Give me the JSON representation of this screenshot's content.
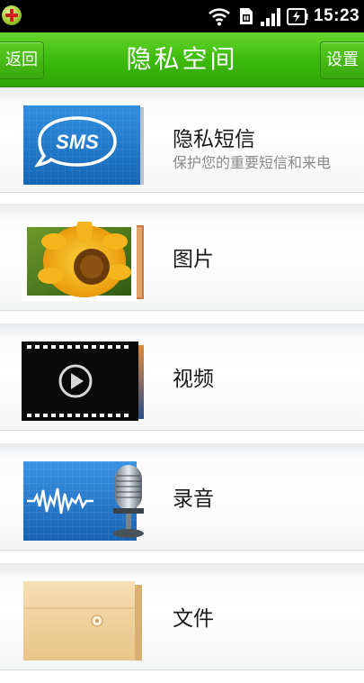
{
  "status_bar": {
    "time": "15:23",
    "icons": [
      "app-plus-icon",
      "wifi-icon",
      "sim-icon",
      "signal-icon",
      "battery-charging-icon"
    ]
  },
  "title_bar": {
    "title": "隐私空间",
    "back_label": "返回",
    "settings_label": "设置",
    "accent": "#3fbd0f"
  },
  "items": [
    {
      "title": "隐私短信",
      "subtitle": "保护您的重要短信和来电",
      "icon": "sms-icon",
      "icon_text": "SMS"
    },
    {
      "title": "图片",
      "subtitle": "",
      "icon": "picture-icon"
    },
    {
      "title": "视频",
      "subtitle": "",
      "icon": "video-icon"
    },
    {
      "title": "录音",
      "subtitle": "",
      "icon": "microphone-icon"
    },
    {
      "title": "文件",
      "subtitle": "",
      "icon": "folder-icon"
    }
  ]
}
